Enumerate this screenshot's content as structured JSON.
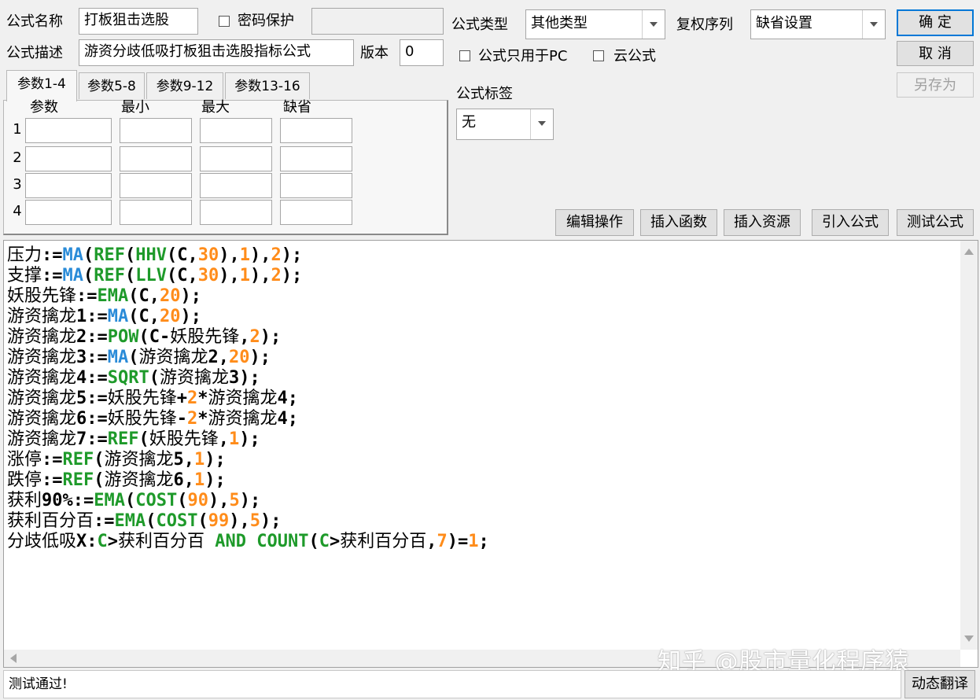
{
  "formula_name": {
    "label": "公式名称",
    "value": "打板狙击选股"
  },
  "password": {
    "label": "密码保护",
    "checked": false,
    "value": ""
  },
  "formula_desc": {
    "label": "公式描述",
    "value": "游资分歧低吸打板狙击选股指标公式"
  },
  "version": {
    "label": "版本",
    "value": "0"
  },
  "formula_type": {
    "label": "公式类型",
    "value": "其他类型"
  },
  "rights": {
    "label": "复权序列",
    "value": "缺省设置"
  },
  "pc_only": {
    "label": "公式只用于PC",
    "checked": false
  },
  "cloud": {
    "label": "云公式",
    "checked": false
  },
  "tag": {
    "label": "公式标签",
    "value": "无"
  },
  "buttons": {
    "ok": "确 定",
    "cancel": "取 消",
    "save_as": "另存为",
    "edit_ops": "编辑操作",
    "insert_func": "插入函数",
    "insert_res": "插入资源",
    "import": "引入公式",
    "test": "测试公式",
    "translate": "动态翻译"
  },
  "param_tabs": [
    "参数1-4",
    "参数5-8",
    "参数9-12",
    "参数13-16"
  ],
  "param_columns": [
    "参数",
    "最小",
    "最大",
    "缺省"
  ],
  "param_rows": [
    "1",
    "2",
    "3",
    "4"
  ],
  "code_lines": [
    [
      [
        "t",
        "压力"
      ],
      [
        "s",
        ":="
      ],
      [
        "m",
        "MA"
      ],
      [
        "s",
        "("
      ],
      [
        "f",
        "REF"
      ],
      [
        "s",
        "("
      ],
      [
        "f",
        "HHV"
      ],
      [
        "s",
        "("
      ],
      [
        "s",
        "C,"
      ],
      [
        "n",
        "30"
      ],
      [
        "s",
        "),"
      ],
      [
        "n",
        "1"
      ],
      [
        "s",
        "),"
      ],
      [
        "n",
        "2"
      ],
      [
        "s",
        ");"
      ]
    ],
    [
      [
        "t",
        "支撑"
      ],
      [
        "s",
        ":="
      ],
      [
        "m",
        "MA"
      ],
      [
        "s",
        "("
      ],
      [
        "f",
        "REF"
      ],
      [
        "s",
        "("
      ],
      [
        "f",
        "LLV"
      ],
      [
        "s",
        "("
      ],
      [
        "s",
        "C,"
      ],
      [
        "n",
        "30"
      ],
      [
        "s",
        "),"
      ],
      [
        "n",
        "1"
      ],
      [
        "s",
        "),"
      ],
      [
        "n",
        "2"
      ],
      [
        "s",
        ");"
      ]
    ],
    [
      [
        "t",
        "妖股先锋"
      ],
      [
        "s",
        ":="
      ],
      [
        "f",
        "EMA"
      ],
      [
        "s",
        "("
      ],
      [
        "s",
        "C,"
      ],
      [
        "n",
        "20"
      ],
      [
        "s",
        ");"
      ]
    ],
    [
      [
        "t",
        "游资擒龙"
      ],
      [
        "s",
        "1:="
      ],
      [
        "m",
        "MA"
      ],
      [
        "s",
        "("
      ],
      [
        "s",
        "C,"
      ],
      [
        "n",
        "20"
      ],
      [
        "s",
        ");"
      ]
    ],
    [
      [
        "t",
        "游资擒龙"
      ],
      [
        "s",
        "2:="
      ],
      [
        "f",
        "POW"
      ],
      [
        "s",
        "("
      ],
      [
        "s",
        "C-"
      ],
      [
        "t",
        "妖股先锋"
      ],
      [
        "s",
        ","
      ],
      [
        "n",
        "2"
      ],
      [
        "s",
        ");"
      ]
    ],
    [
      [
        "t",
        "游资擒龙"
      ],
      [
        "s",
        "3:="
      ],
      [
        "m",
        "MA"
      ],
      [
        "s",
        "("
      ],
      [
        "t",
        "游资擒龙"
      ],
      [
        "s",
        "2,"
      ],
      [
        "n",
        "20"
      ],
      [
        "s",
        ");"
      ]
    ],
    [
      [
        "t",
        "游资擒龙"
      ],
      [
        "s",
        "4:="
      ],
      [
        "f",
        "SQRT"
      ],
      [
        "s",
        "("
      ],
      [
        "t",
        "游资擒龙"
      ],
      [
        "s",
        "3);"
      ]
    ],
    [
      [
        "t",
        "游资擒龙"
      ],
      [
        "s",
        "5:="
      ],
      [
        "t",
        "妖股先锋"
      ],
      [
        "s",
        "+"
      ],
      [
        "n",
        "2"
      ],
      [
        "s",
        "*"
      ],
      [
        "t",
        "游资擒龙"
      ],
      [
        "s",
        "4;"
      ]
    ],
    [
      [
        "t",
        "游资擒龙"
      ],
      [
        "s",
        "6:="
      ],
      [
        "t",
        "妖股先锋"
      ],
      [
        "s",
        "-"
      ],
      [
        "n",
        "2"
      ],
      [
        "s",
        "*"
      ],
      [
        "t",
        "游资擒龙"
      ],
      [
        "s",
        "4;"
      ]
    ],
    [
      [
        "t",
        "游资擒龙"
      ],
      [
        "s",
        "7:="
      ],
      [
        "f",
        "REF"
      ],
      [
        "s",
        "("
      ],
      [
        "t",
        "妖股先锋"
      ],
      [
        "s",
        ","
      ],
      [
        "n",
        "1"
      ],
      [
        "s",
        ");"
      ]
    ],
    [
      [
        "t",
        "涨停"
      ],
      [
        "s",
        ":="
      ],
      [
        "f",
        "REF"
      ],
      [
        "s",
        "("
      ],
      [
        "t",
        "游资擒龙"
      ],
      [
        "s",
        "5,"
      ],
      [
        "n",
        "1"
      ],
      [
        "s",
        ");"
      ]
    ],
    [
      [
        "t",
        "跌停"
      ],
      [
        "s",
        ":="
      ],
      [
        "f",
        "REF"
      ],
      [
        "s",
        "("
      ],
      [
        "t",
        "游资擒龙"
      ],
      [
        "s",
        "6,"
      ],
      [
        "n",
        "1"
      ],
      [
        "s",
        ");"
      ]
    ],
    [
      [
        "t",
        "获利"
      ],
      [
        "s",
        "90%:="
      ],
      [
        "f",
        "EMA"
      ],
      [
        "s",
        "("
      ],
      [
        "f",
        "COST"
      ],
      [
        "s",
        "("
      ],
      [
        "n",
        "90"
      ],
      [
        "s",
        "),"
      ],
      [
        "n",
        "5"
      ],
      [
        "s",
        ");"
      ]
    ],
    [
      [
        "t",
        "获利百分百"
      ],
      [
        "s",
        ":="
      ],
      [
        "f",
        "EMA"
      ],
      [
        "s",
        "("
      ],
      [
        "f",
        "COST"
      ],
      [
        "s",
        "("
      ],
      [
        "n",
        "99"
      ],
      [
        "s",
        "),"
      ],
      [
        "n",
        "5"
      ],
      [
        "s",
        ");"
      ]
    ],
    [
      [
        "t",
        "分歧低吸"
      ],
      [
        "s",
        "X:"
      ],
      [
        "f",
        "C"
      ],
      [
        "s",
        ">"
      ],
      [
        "t",
        "获利百分百"
      ],
      [
        "s",
        " "
      ],
      [
        "k",
        "AND"
      ],
      [
        "s",
        " "
      ],
      [
        "k",
        "COUNT"
      ],
      [
        "s",
        "("
      ],
      [
        "f",
        "C"
      ],
      [
        "s",
        ">"
      ],
      [
        "t",
        "获利百分百"
      ],
      [
        "s",
        ","
      ],
      [
        "n",
        "7"
      ],
      [
        "s",
        ")="
      ],
      [
        "n",
        "1"
      ],
      [
        "s",
        ";"
      ]
    ]
  ],
  "status_text": "测试通过!",
  "watermark": "知乎 @股市量化程序猿",
  "colors": {
    "func": "#1e9a2a",
    "ma": "#2a8bd8",
    "number": "#ff8c1a",
    "focus": "#0078d7"
  }
}
